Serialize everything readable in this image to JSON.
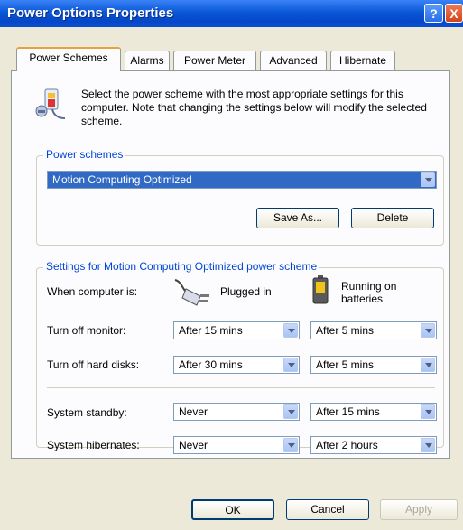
{
  "window": {
    "title": "Power Options Properties",
    "help_label": "?",
    "close_label": "X"
  },
  "tabs": [
    {
      "label": "Power Schemes",
      "active": true
    },
    {
      "label": "Alarms",
      "active": false
    },
    {
      "label": "Power Meter",
      "active": false
    },
    {
      "label": "Advanced",
      "active": false
    },
    {
      "label": "Hibernate",
      "active": false
    }
  ],
  "description": "Select the power scheme with the most appropriate settings for this computer. Note that changing the settings below will modify the selected scheme.",
  "schemes": {
    "legend": "Power schemes",
    "selected": "Motion Computing Optimized",
    "save_as": "Save As...",
    "delete": "Delete"
  },
  "settings": {
    "legend": "Settings for Motion Computing Optimized power scheme",
    "when_label": "When computer is:",
    "plugged_label": "Plugged in",
    "battery_label_1": "Running on",
    "battery_label_2": "batteries",
    "rows": [
      {
        "label": "Turn off monitor:",
        "plugged": "After 15 mins",
        "battery": "After 5 mins"
      },
      {
        "label": "Turn off hard disks:",
        "plugged": "After 30 mins",
        "battery": "After 5 mins"
      },
      {
        "label": "System standby:",
        "plugged": "Never",
        "battery": "After 15 mins"
      },
      {
        "label": "System hibernates:",
        "plugged": "Never",
        "battery": "After 2 hours"
      }
    ]
  },
  "footer": {
    "ok": "OK",
    "cancel": "Cancel",
    "apply": "Apply"
  },
  "colors": {
    "titlebar": "#0a58d8",
    "accent_text": "#0046d5",
    "selection": "#316ac5"
  }
}
